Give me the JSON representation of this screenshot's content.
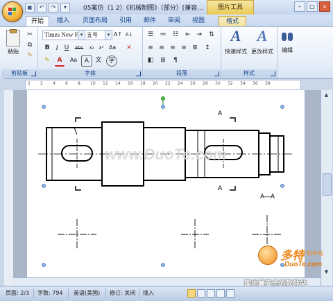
{
  "title_bar": {
    "document_title": "05案仿（1 2）《机械制图》（部分）[兼容...",
    "context_tab_title": "图片工具",
    "qat": [
      "save-icon",
      "undo-icon",
      "redo-icon",
      "customize-icon"
    ],
    "window_buttons": [
      "–",
      "□",
      "×"
    ]
  },
  "tabs": [
    {
      "label": "开始",
      "active": true
    },
    {
      "label": "插入",
      "active": false
    },
    {
      "label": "页面布局",
      "active": false
    },
    {
      "label": "引用",
      "active": false
    },
    {
      "label": "邮件",
      "active": false
    },
    {
      "label": "审阅",
      "active": false
    },
    {
      "label": "视图",
      "active": false
    },
    {
      "label": "格式",
      "active": false,
      "contextual": true
    }
  ],
  "ribbon": {
    "clipboard": {
      "label": "剪贴板",
      "paste": "粘贴"
    },
    "font": {
      "label": "字体",
      "font_name": "Times New F",
      "font_size": "五号"
    },
    "paragraph": {
      "label": "段落"
    },
    "styles": {
      "label": "样式",
      "quick_styles": "快速样式",
      "change_styles": "更改样式"
    },
    "editing": {
      "label": "编辑"
    }
  },
  "ruler": {
    "ticks": [
      "2",
      "2",
      "4",
      "6",
      "8",
      "10",
      "12",
      "14",
      "16",
      "18",
      "20",
      "22",
      "24",
      "26",
      "28",
      "30",
      "32",
      "34",
      "36",
      "38"
    ]
  },
  "drawing": {
    "section_label_top": "A",
    "section_label_bottom": "A",
    "section_caption": "A—A",
    "watermark_text": "www.DuoTe.com"
  },
  "watermark": {
    "brand_cn": "多特",
    "brand_cn_sub": "软件站",
    "brand_en": "DuoTe.com",
    "slogan": "国内最安全的软件站"
  },
  "status_bar": {
    "page": "页面: 2/3",
    "words": "字数: 794",
    "language": "英语(美国)",
    "track": "修订: 关闭",
    "insert": "插入"
  },
  "colors": {
    "accent": "#15428b",
    "contextual": "#e9c94f",
    "watermark_orange": "#f08a1c"
  }
}
